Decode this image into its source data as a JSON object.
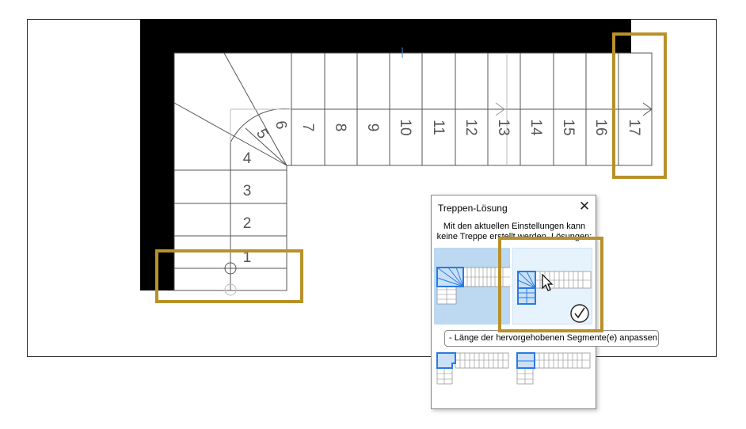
{
  "plan": {
    "step_numbers": [
      "1",
      "2",
      "3",
      "4",
      "5",
      "6",
      "7",
      "8",
      "9",
      "10",
      "11",
      "12",
      "13",
      "14",
      "15",
      "16",
      "17"
    ]
  },
  "dialog": {
    "title": "Treppen-Lösung",
    "close_icon": "close-icon",
    "message_line1": "Mit den aktuellen Einstellungen kann",
    "message_line2": "keine Treppe erstellt werden. Lösungen:",
    "selected_icon": "checkmark-circle-icon"
  },
  "tooltip": {
    "text": "- Länge der hervorgehobenen Segmente(e) anpassen"
  },
  "colors": {
    "highlight_frame": "#b8912a",
    "segment_blue": "#2a7ae2",
    "option_selected_bg": "#bcd9f1",
    "option_hover_bg": "#e6f2fc",
    "wall": "#000000"
  }
}
